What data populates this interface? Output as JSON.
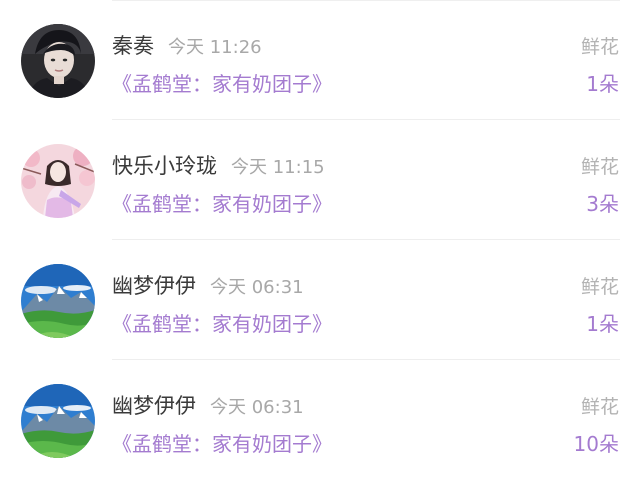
{
  "rows": [
    {
      "name": "秦奏",
      "time": "今天 11:26",
      "book": "《孟鹤堂：家有奶团子》",
      "gift": "鲜花",
      "count": "1朵",
      "avatar": "portrait-boy-dark"
    },
    {
      "name": "快乐小玲珑",
      "time": "今天 11:15",
      "book": "《孟鹤堂：家有奶团子》",
      "gift": "鲜花",
      "count": "3朵",
      "avatar": "portrait-girl-blossoms"
    },
    {
      "name": "幽梦伊伊",
      "time": "今天 06:31",
      "book": "《孟鹤堂：家有奶团子》",
      "gift": "鲜花",
      "count": "1朵",
      "avatar": "mountain-landscape"
    },
    {
      "name": "幽梦伊伊",
      "time": "今天 06:31",
      "book": "《孟鹤堂：家有奶团子》",
      "gift": "鲜花",
      "count": "10朵",
      "avatar": "mountain-landscape"
    }
  ],
  "colors": {
    "accent": "#a47bd0",
    "name": "#3a3a3a",
    "muted": "#a8a8a8"
  }
}
